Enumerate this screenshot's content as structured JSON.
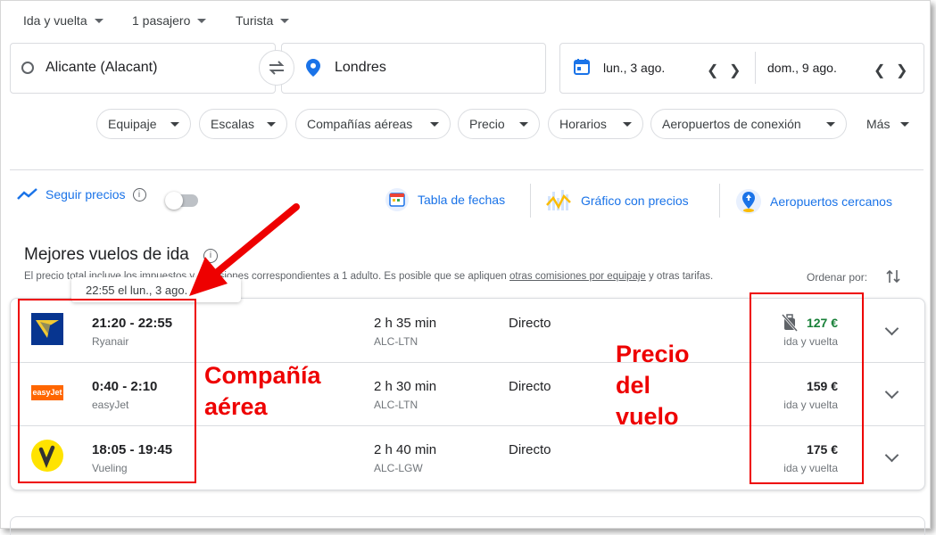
{
  "top": {
    "trip_type": "Ida y vuelta",
    "passengers": "1 pasajero",
    "class": "Turista"
  },
  "search": {
    "origin": "Alicante (Alacant)",
    "destination": "Londres",
    "depart_date": "lun., 3 ago.",
    "return_date": "dom., 9 ago."
  },
  "filters": [
    "Equipaje",
    "Escalas",
    "Compañías aéreas",
    "Precio",
    "Horarios",
    "Aeropuertos de conexión",
    "Más"
  ],
  "tools": {
    "track_prices": "Seguir precios",
    "date_grid": "Tabla de fechas",
    "price_graph": "Gráfico con precios",
    "nearby_airports": "Aeropuertos cercanos"
  },
  "results": {
    "title": "Mejores vuelos de ida",
    "note_prefix": "El precio total incluye los impuestos y comisiones correspondientes a 1 adulto. Es posible que se apliquen ",
    "note_link": "otras comisiones por equipaje",
    "note_suffix": " y otras tarifas.",
    "sort_label": "Ordenar por:",
    "tooltip": "22:55 el lun., 3 ago."
  },
  "flights": [
    {
      "times": "21:20 - 22:55",
      "airline": "Ryanair",
      "duration": "2 h 35 min",
      "route": "ALC-LTN",
      "stops": "Directo",
      "price": "127 €",
      "price_note": "ida y vuelta",
      "logo": "ryanair-logo"
    },
    {
      "times": "0:40 - 2:10",
      "airline": "easyJet",
      "duration": "2 h 30 min",
      "route": "ALC-LTN",
      "stops": "Directo",
      "price": "159 €",
      "price_note": "ida y vuelta",
      "logo": "easyjet-logo"
    },
    {
      "times": "18:05 - 19:45",
      "airline": "Vueling",
      "duration": "2 h 40 min",
      "route": "ALC-LGW",
      "stops": "Directo",
      "price": "175 €",
      "price_note": "ida y vuelta",
      "logo": "vueling-logo"
    }
  ],
  "annotations": {
    "airline_label_1": "Compañía",
    "airline_label_2": "aérea",
    "price_label_1": "Precio",
    "price_label_2": "del",
    "price_label_3": "vuelo"
  },
  "logos": {
    "easyjet": "easyJet"
  },
  "colors": {
    "accent": "#1a73e8",
    "cheap_price": "#188038",
    "annotation": "#ee0000"
  }
}
